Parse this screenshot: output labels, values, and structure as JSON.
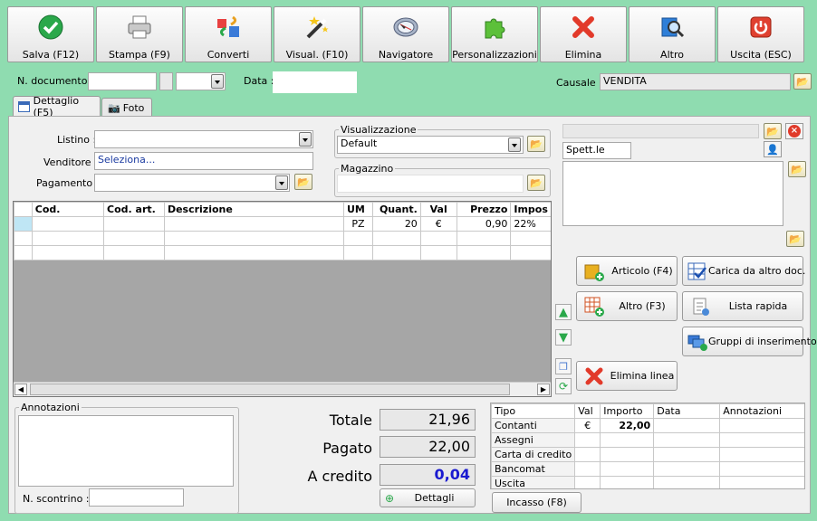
{
  "toolbar": {
    "save": "Salva (F12)",
    "print": "Stampa (F9)",
    "convert": "Converti",
    "view": "Visual. (F10)",
    "navigator": "Navigatore",
    "custom": "Personalizzazioni",
    "delete": "Elimina",
    "other": "Altro",
    "exit": "Uscita (ESC)"
  },
  "header": {
    "doc_number_label": "N. documento :",
    "doc_number": "",
    "date_label": "Data :",
    "date": "",
    "causale_label": "Causale :",
    "causale": "VENDITA"
  },
  "tabs": {
    "detail": "Dettaglio (F5)",
    "photo": "Foto"
  },
  "form": {
    "listino_label": "Listino :",
    "listino": "",
    "venditore_label": "Venditore :",
    "venditore": "Seleziona...",
    "pagamento_label": "Pagamento :",
    "pagamento": "",
    "visualizzazione_label": "Visualizzazione",
    "visualizzazione": "Default",
    "magazzino_label": "Magazzino",
    "magazzino": "",
    "customer_name": "",
    "customer_greeting": "Spett.le",
    "customer_address": ""
  },
  "grid": {
    "headers": [
      "Cod.",
      "Cod. art.",
      "Descrizione",
      "UM",
      "Quant.",
      "Val",
      "Prezzo",
      "Impos"
    ],
    "rows": [
      [
        "",
        "",
        "",
        "PZ",
        "20",
        "€",
        "0,90",
        "22%"
      ],
      [
        "",
        "",
        "",
        "",
        "",
        "",
        "",
        ""
      ],
      [
        "",
        "",
        "",
        "",
        "",
        "",
        "",
        ""
      ]
    ]
  },
  "actions": {
    "articolo": "Articolo (F4)",
    "carica": "Carica da altro doc.",
    "altro": "Altro (F3)",
    "lista": "Lista rapida",
    "gruppi": "Gruppi di inserimento",
    "elimina_linea": "Elimina linea"
  },
  "notes": {
    "label": "Annotazioni",
    "value": "",
    "receipt_label": "N. scontrino :",
    "receipt": ""
  },
  "totals": {
    "totale_label": "Totale",
    "totale": "21,96",
    "pagato_label": "Pagato",
    "pagato": "22,00",
    "credito_label": "A credito",
    "credito": "0,04",
    "details_button": "Dettagli"
  },
  "payments": {
    "headers": [
      "Tipo",
      "Val",
      "Importo",
      "Data",
      "Annotazioni"
    ],
    "rows": [
      [
        "Contanti",
        "€",
        "22,00",
        "",
        ""
      ],
      [
        "Assegni",
        "",
        "",
        "",
        ""
      ],
      [
        "Carta di credito",
        "",
        "",
        "",
        ""
      ],
      [
        "Bancomat",
        "",
        "",
        "",
        ""
      ],
      [
        "Uscita",
        "",
        "",
        "",
        ""
      ]
    ],
    "incasso_button": "Incasso (F8)"
  },
  "colors": {
    "background": "#8fdcb0",
    "credit_value": "#1a1ad0"
  }
}
